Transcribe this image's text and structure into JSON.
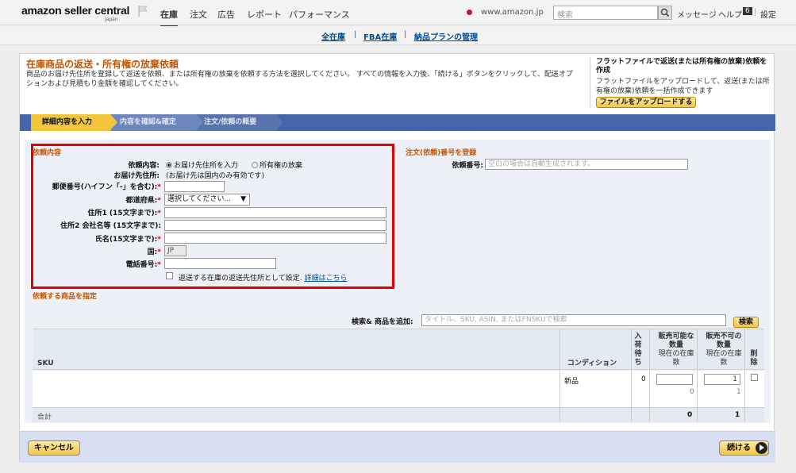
{
  "header": {
    "logo": "amazon seller central",
    "logo_sub": "japan",
    "nav": [
      "在庫",
      "注文",
      "広告",
      "レポート",
      "パフォーマンス"
    ],
    "site": "www.amazon.jp",
    "search_placeholder": "検索",
    "messages": "メッセージ",
    "help": "ヘルプ",
    "help_count": "6",
    "settings": "設定"
  },
  "subnav": [
    "全在庫",
    "FBA在庫",
    "納品プランの管理"
  ],
  "page": {
    "title": "在庫商品の返送・所有権の放棄依頼",
    "description": "商品のお届け先住所を登録して返送を依頼、または所有権の放棄を依頼する方法を選択してください。 すべての情報を入力後、「続ける」ボタンをクリックして、配送オプションおよび見積もり金額を確認してください。",
    "side_title": "フラットファイルで返送(または所有権の放棄)依頼を作成",
    "side_desc": "フラットファイルをアップロードして、返送(または所有権の放棄)依頼を一括作成できます",
    "upload_button": "ファイルをアップロードする"
  },
  "steps": [
    "詳細内容を入力",
    "内容を確認&確定",
    "注文/依頼の概要"
  ],
  "request": {
    "section_title": "依頼内容",
    "type_label": "依頼内容:",
    "type_options": [
      "お届け先住所を入力",
      "所有権の放棄"
    ],
    "address_label": "お届け先住所:",
    "address_note": "(お届け先は国内のみ有効です)",
    "postal_label": "郵便番号(ハイフン「-」を含む):",
    "prefecture_label": "都道府県:",
    "prefecture_value": "選択してください...",
    "address1_label": "住所1 (15文字まで):",
    "address2_label": "住所2 会社名等 (15文字まで):",
    "name_label": "氏名(15文字まで):",
    "country_label": "国:",
    "country_value": "JP",
    "phone_label": "電話番号:",
    "checkbox_label": "返送する在庫の返送先住所として設定.",
    "details_link": "詳細はこちら"
  },
  "order_id": {
    "section_title": "注文(依頼)番号を登録",
    "label": "依頼番号:",
    "placeholder": "空白の場合は自動生成されます。"
  },
  "products": {
    "section_title": "依頼する商品を指定",
    "search_label": "検索& 商品を追加:",
    "search_placeholder": "タイトル、SKU, ASIN, またはFNSKUで検索",
    "search_button": "検索",
    "headers": {
      "sku": "SKU",
      "condition": "コンディション",
      "inbound": "入荷待ち",
      "sellable": "販売可能な数量",
      "sellable_sub": "現在の在庫数",
      "unsellable": "販売不可の数量",
      "unsellable_sub": "現在の在庫数",
      "remove": "削除"
    },
    "rows": [
      {
        "sku": "",
        "condition": "新品",
        "inbound": "0",
        "sellable_value": "",
        "sellable_stock": "0",
        "unsellable_value": "1",
        "unsellable_stock": "1"
      }
    ],
    "total_label": "合計",
    "total_sellable": "0",
    "total_unsellable": "1"
  },
  "footer": {
    "cancel": "キャンセル",
    "continue": "続ける"
  }
}
